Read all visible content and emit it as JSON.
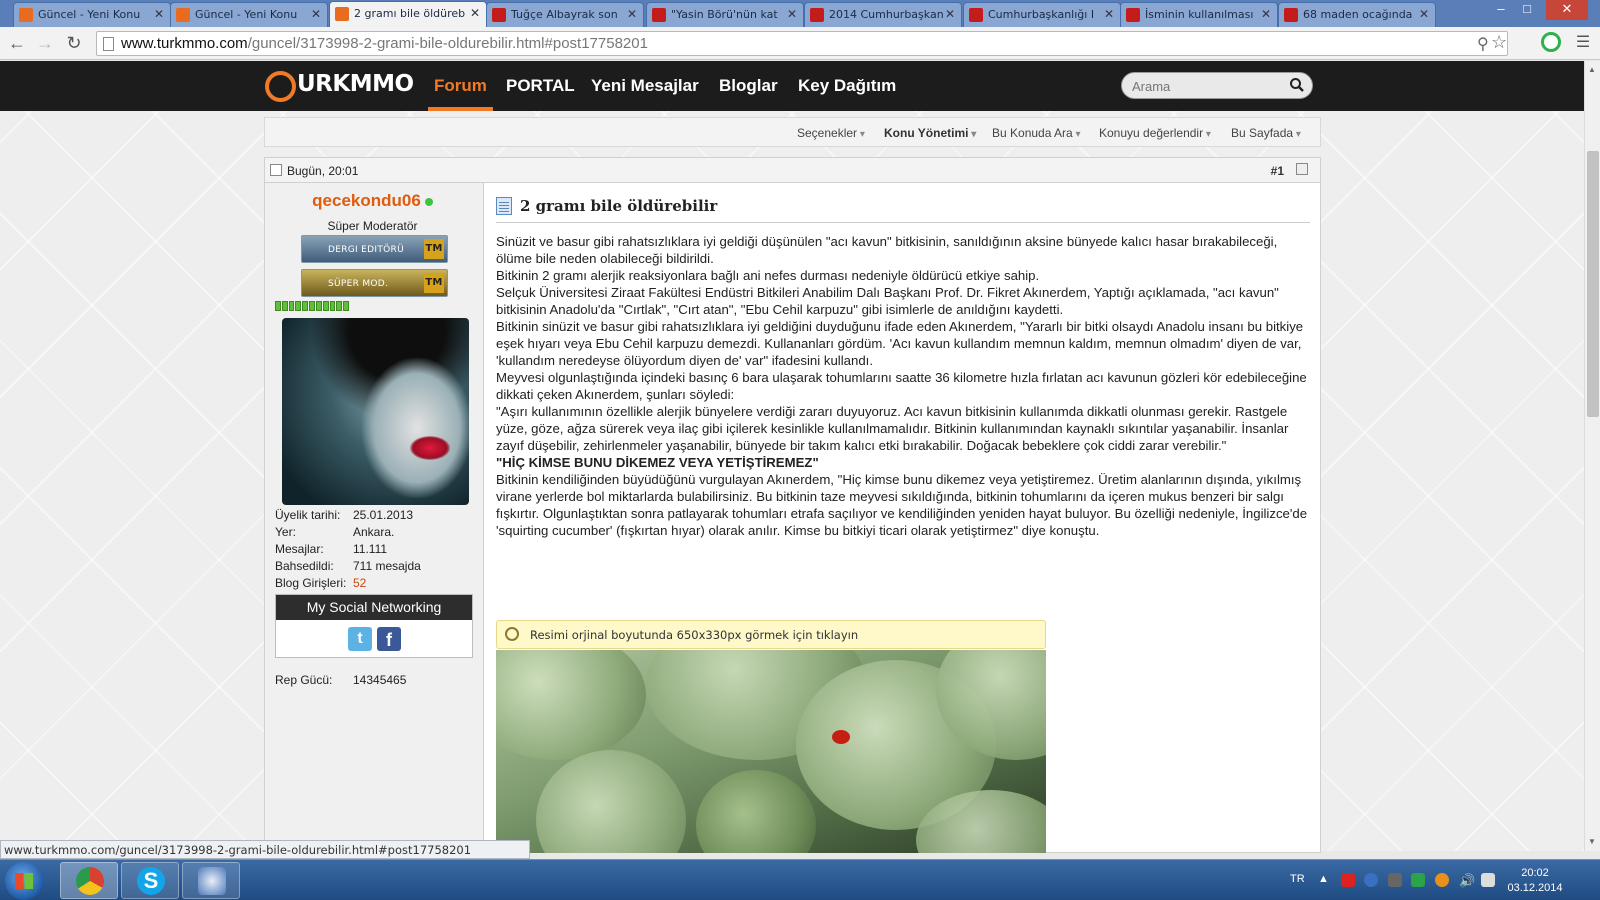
{
  "browser": {
    "tabs": [
      {
        "title": "Güncel - Yeni Konu",
        "icon": "turkmmo",
        "active": false
      },
      {
        "title": "Güncel - Yeni Konu",
        "icon": "turkmmo",
        "active": false
      },
      {
        "title": "2 gramı bile öldüreb",
        "icon": "turkmmo",
        "active": true
      },
      {
        "title": "Tuğçe Albayrak son",
        "icon": "trt-haber",
        "active": false
      },
      {
        "title": "\"Yasin Börü'nün kat",
        "icon": "trt-haber",
        "active": false
      },
      {
        "title": "2014 Cumhurbaşkan",
        "icon": "trt-haber",
        "active": false
      },
      {
        "title": "Cumhurbaşkanlığı I",
        "icon": "trt-haber",
        "active": false
      },
      {
        "title": "İsminin kullanılması",
        "icon": "trt-haber",
        "active": false
      },
      {
        "title": "68 maden ocağında",
        "icon": "trt-haber",
        "active": false
      }
    ],
    "url_host": "www.turkmmo.com",
    "url_path": "/guncel/3173998-2-grami-bile-oldurebilir.html#post17758201",
    "status_url": "www.turkmmo.com/guncel/3173998-2-grami-bile-oldurebilir.html#post17758201"
  },
  "site": {
    "logo_text": "URKMMO",
    "nav": [
      "Forum",
      "PORTAL",
      "Yeni Mesajlar",
      "Bloglar",
      "Key Dağıtım"
    ],
    "nav_active": "Forum",
    "search_placeholder": "Arama",
    "accent": "#f07a26"
  },
  "thread_tools": [
    "Seçenekler",
    "Konu Yönetimi",
    "Bu Konuda Ara",
    "Konuyu değerlendir",
    "Bu Sayfada"
  ],
  "post": {
    "date": "Bugün, 20:01",
    "number": "#1",
    "title": "2 gramı bile öldürebilir",
    "paragraphs": [
      "Sinüzit ve basur gibi rahatsızlıklara iyi geldiği düşünülen \"acı kavun\" bitkisinin, sanıldığının aksine bünyede kalıcı hasar bırakabileceği, ölüme bile neden olabileceği bildirildi.",
      "Bitkinin 2 gramı alerjik reaksiyonlara bağlı ani nefes durması nedeniyle öldürücü etkiye sahip.",
      "Selçuk Üniversitesi Ziraat Fakültesi Endüstri Bitkileri Anabilim Dalı Başkanı Prof. Dr. Fikret Akınerdem, Yaptığı açıklamada, \"acı kavun\" bitkisinin Anadolu'da \"Cırtlak\", \"Cırt atan\", \"Ebu Cehil karpuzu\" gibi isimlerle de anıldığını kaydetti.",
      "Bitkinin sinüzit ve basur gibi rahatsızlıklara iyi geldiğini duyduğunu ifade eden Akınerdem, \"Yararlı bir bitki olsaydı Anadolu insanı bu bitkiye eşek hıyarı veya Ebu Cehil karpuzu demezdi. Kullananları gördüm. 'Acı kavun kullandım memnun kaldım, memnun olmadım' diyen de var, 'kullandım neredeyse ölüyordum diyen de' var\" ifadesini kullandı.",
      "Meyvesi olgunlaştığında içindeki basınç 6 bara ulaşarak tohumlarını saatte 36 kilometre hızla fırlatan acı kavunun gözleri kör edebileceğine dikkati çeken Akınerdem, şunları söyledi:",
      "\"Aşırı kullanımının özellikle alerjik bünyelere verdiği zararı duyuyoruz. Acı kavun bitkisinin kullanımda dikkatli olunması gerekir. Rastgele yüze, göze, ağza sürerek veya ilaç gibi içilerek kesinlikle kullanılmamalıdır. Bitkinin kullanımından kaynaklı sıkıntılar yaşanabilir. İnsanlar zayıf düşebilir, zehirlenmeler yaşanabilir, bünyede bir takım kalıcı etki bırakabilir. Doğacak bebeklere çok ciddi zarar verebilir.\""
    ],
    "subheading": "\"HİÇ KİMSE BUNU DİKEMEZ VEYA YETİŞTİREMEZ\"",
    "paragraphs2": [
      "Bitkinin kendiliğinden büyüdüğünü vurgulayan Akınerdem, \"Hiç kimse bunu dikemez veya yetiştiremez. Üretim alanlarının dışında, yıkılmış virane yerlerde bol miktarlarda bulabilirsiniz. Bu bitkinin taze meyvesi sıkıldığında, bitkinin tohumlarını da içeren mukus benzeri bir salgı fışkırtır. Olgunlaştıktan sonra patlayarak tohumları etrafa saçılıyor ve kendiliğinden yeniden hayat buluyor. Bu özelliği nedeniyle, İngilizce'de 'squirting cucumber' (fışkırtan hıyar) olarak anılır. Kimse bu bitkiyi ticari olarak yetiştirmez\" diye konuştu."
    ],
    "image_notice": "Resimi orjinal boyutunda 650x330px görmek için tıklayın"
  },
  "user": {
    "name": "qecekondu06",
    "title": "Süper Moderatör",
    "badges": [
      "DERGI EDITÖRÜ",
      "SÜPER MOD."
    ],
    "badge_suffix": "TM",
    "meta": [
      {
        "k": "Üyelik tarihi:",
        "v": "25.01.2013",
        "link": false
      },
      {
        "k": "Yer:",
        "v": "Ankara.",
        "link": false
      },
      {
        "k": "Mesajlar:",
        "v": "11.111",
        "link": false
      },
      {
        "k": "Bahsedildi:",
        "v": "711 mesajda",
        "link": false
      },
      {
        "k": "Blog Girişleri:",
        "v": "52",
        "link": true
      }
    ],
    "social_title": "My Social Networking",
    "rep_label": "Rep Gücü:",
    "rep_value": "14345465"
  },
  "taskbar": {
    "lang": "TR",
    "time": "20:02",
    "date": "03.12.2014"
  }
}
